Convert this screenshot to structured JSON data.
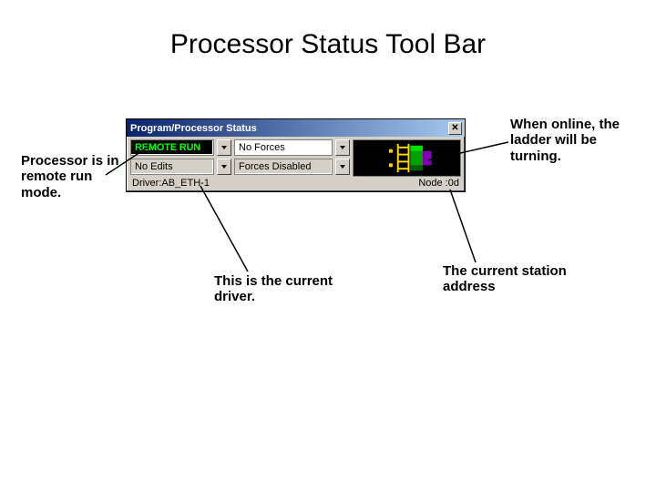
{
  "slide": {
    "title": "Processor Status Tool Bar"
  },
  "annotations": {
    "processor_mode": "Processor is in remote run mode.",
    "ladder_turning": "When online, the ladder will be turning.",
    "current_driver": "This is  the current driver.",
    "station_address": "The current station address"
  },
  "window": {
    "title": "Program/Processor Status",
    "close": "✕",
    "run_mode": "REMOTE RUN",
    "edits": "No Edits",
    "forces": "No Forces",
    "forces_state": "Forces Disabled",
    "driver_label": "Driver: ",
    "driver_value": "AB_ETH-1",
    "node_label": "Node : ",
    "node_value": "0d"
  }
}
